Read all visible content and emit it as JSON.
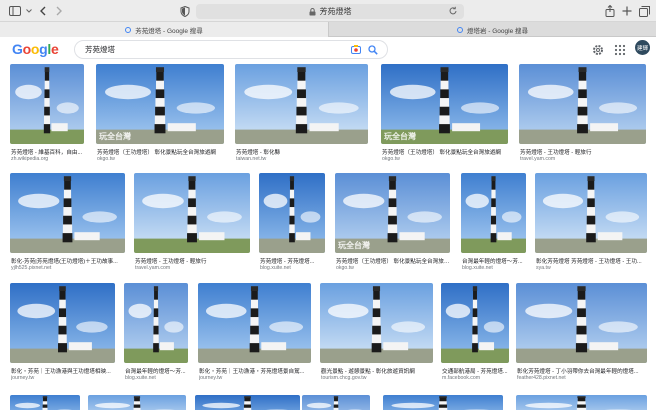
{
  "browser": {
    "address": "芳苑燈塔",
    "tabs": [
      {
        "title": "芳苑燈塔 - Google 搜尋",
        "active": true
      },
      {
        "title": "燈塔岩 - Google 搜尋",
        "active": false
      }
    ]
  },
  "google": {
    "logo": "Google",
    "query": "芳苑燈塔",
    "avatar": "建輝"
  },
  "results": [
    {
      "caption": "芳苑燈塔 - 維基百科，自由...",
      "source": "zh.wikipedia.org",
      "watermark": ""
    },
    {
      "caption": "芳苑燈塔（王功燈塔） 彰化景點玩全台灣旅遊網",
      "source": "okgo.tw",
      "watermark": "玩全台灣"
    },
    {
      "caption": "芳苑燈塔 - 彰化縣",
      "source": "taiwan.net.tw",
      "watermark": ""
    },
    {
      "caption": "芳苑燈塔（王功燈塔） 彰化景點玩全台灣旅遊網",
      "source": "okgo.tw",
      "watermark": "玩全台灣"
    },
    {
      "caption": "芳苑燈塔 - 王功燈塔 - 輕旅行",
      "source": "travel.yam.com",
      "watermark": ""
    },
    {
      "caption": "彰化-芳苑|芳苑燈塔(王功燈塔)＋王功故事...",
      "source": "yjlh525.pixnet.net",
      "watermark": ""
    },
    {
      "caption": "芳苑燈塔 - 王功燈塔 - 輕旅行",
      "source": "travel.yam.com",
      "watermark": ""
    },
    {
      "caption": "芳苑燈塔 - 芳苑燈塔...",
      "source": "blog.xuite.net",
      "watermark": ""
    },
    {
      "caption": "芳苑燈塔（王功燈塔） 彰化景點玩全台灣旅遊網",
      "source": "okgo.tw",
      "watermark": "玩全台灣"
    },
    {
      "caption": "台灣最年輕的燈塔～芳...",
      "source": "blog.xuite.net",
      "watermark": ""
    },
    {
      "caption": "彰化芳苑燈塔 芳苑燈塔 - 王功燈塔 - 王功...",
      "source": "sya.tw",
      "watermark": ""
    },
    {
      "caption": "彰化・芳苑｜王功漁港與王功燈塔相映...",
      "source": "journey.tw",
      "watermark": ""
    },
    {
      "caption": "台灣最年輕的燈塔～芳...",
      "source": "blog.xuite.net",
      "watermark": ""
    },
    {
      "caption": "彰化・芳苑｜王功漁港・芳苑燈塔景自駕...",
      "source": "journey.tw",
      "watermark": ""
    },
    {
      "caption": "觀光景點 - 遊憩景點 - 彰化旅遊資訊網",
      "source": "tourism.chcg.gov.tw",
      "watermark": ""
    },
    {
      "caption": "交通部航港局 - 芳苑燈塔...",
      "source": "m.facebook.com",
      "watermark": ""
    },
    {
      "caption": "彰化芳苑燈塔 - 丁小羽帶你去台灣最年輕的燈塔...",
      "source": "feather428.pixnet.net",
      "watermark": ""
    }
  ]
}
